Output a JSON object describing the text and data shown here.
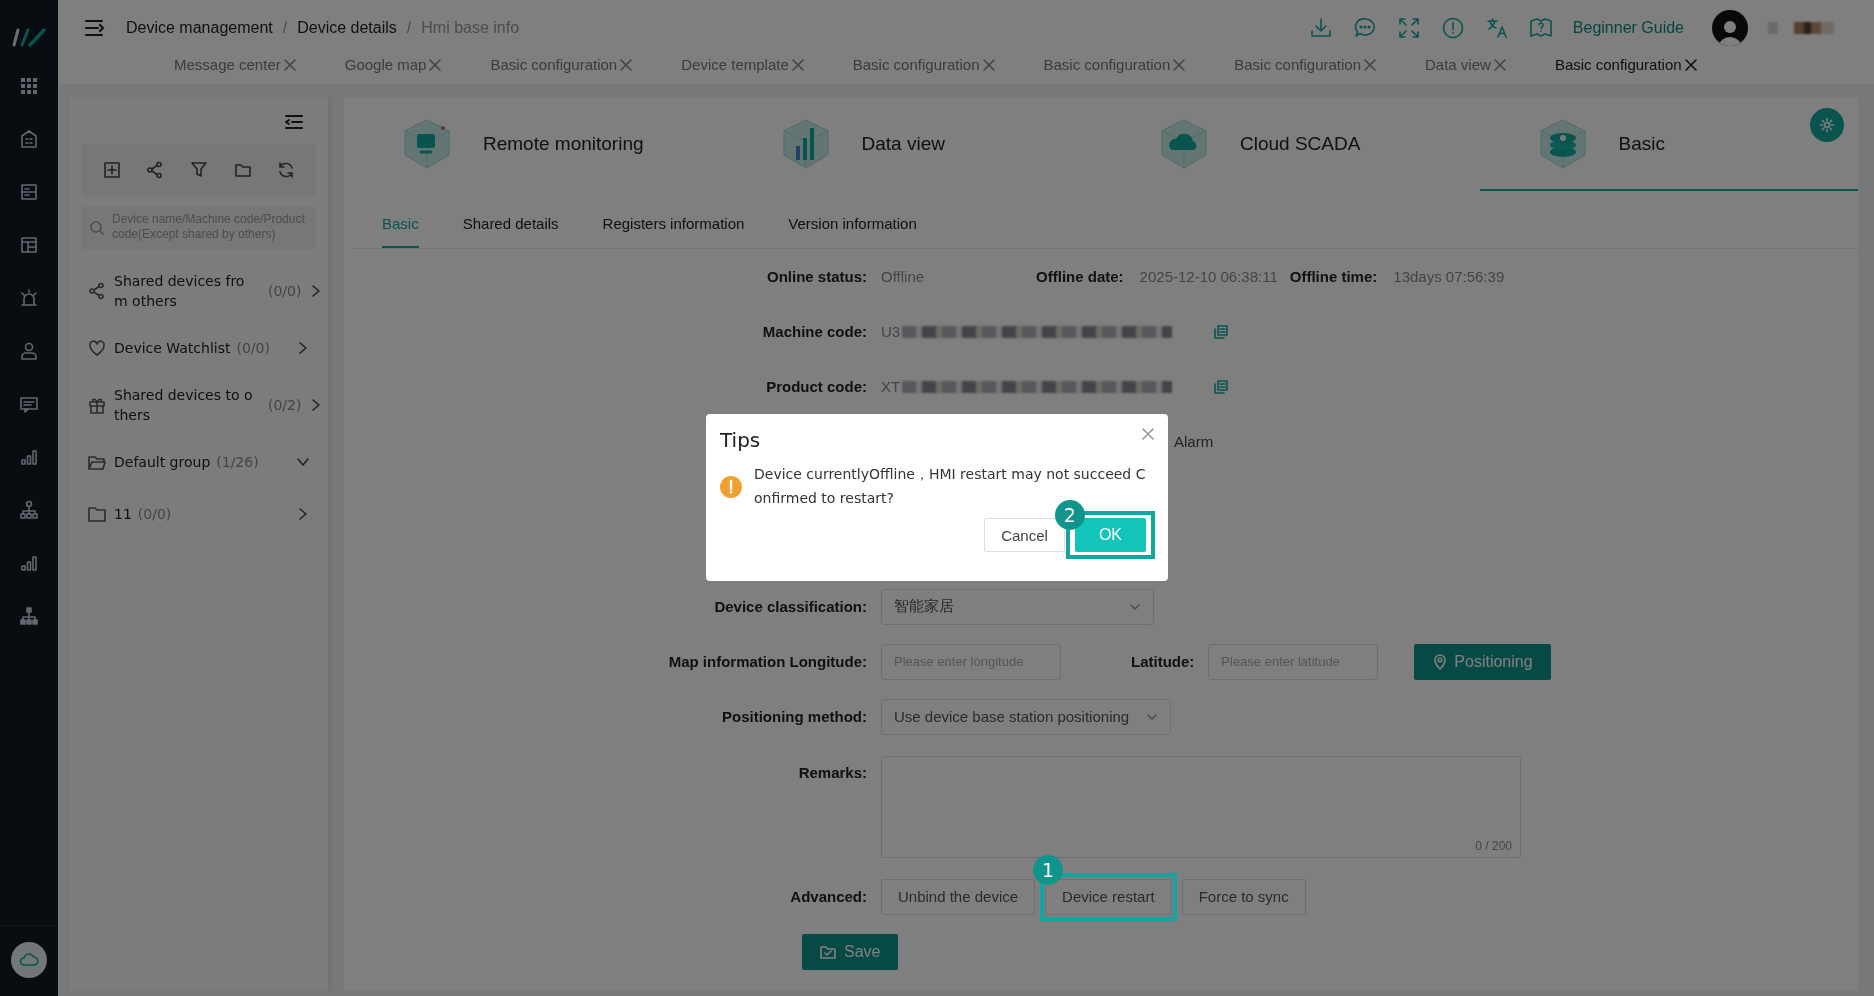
{
  "breadcrumb": [
    {
      "label": "Device management",
      "current": false
    },
    {
      "separator": "/",
      "label": "Device details",
      "current": false
    },
    {
      "separator": "/",
      "label": "Hmi base info",
      "current": true
    }
  ],
  "tabs": [
    {
      "label": "Message center",
      "selected": false
    },
    {
      "label": "Google map",
      "selected": false
    },
    {
      "label": "Basic configuration",
      "selected": false
    },
    {
      "label": "Device template",
      "selected": false
    },
    {
      "label": "Basic configuration",
      "selected": false
    },
    {
      "label": "Basic configuration",
      "selected": false
    },
    {
      "label": "Basic configuration",
      "selected": false
    },
    {
      "label": "Data view",
      "selected": false
    },
    {
      "label": "Basic configuration",
      "selected": true
    }
  ],
  "header": {
    "guide_link": "Beginner Guide"
  },
  "sidebar": {
    "search_placeholder": "Device name/Machine code/Product code(Except shared by others)",
    "items": [
      {
        "kind": "share",
        "label": "Shared devices from others",
        "count": "(0/0)",
        "expanded": false
      },
      {
        "kind": "heart",
        "label": "Device Watchlist",
        "count": "(0/0)",
        "expanded": false
      },
      {
        "kind": "gift",
        "label": "Shared devices to others",
        "count": "(0/2)",
        "expanded": false
      },
      {
        "kind": "folder-open",
        "label": "Default group",
        "count": "(1/26)",
        "expanded": true
      },
      {
        "kind": "folder",
        "label": "11",
        "count": "(0/0)",
        "expanded": false
      }
    ]
  },
  "modules": [
    {
      "label": "Remote monitoring",
      "selected": false
    },
    {
      "label": "Data view",
      "selected": false
    },
    {
      "label": "Cloud SCADA",
      "selected": false
    },
    {
      "label": "Basic",
      "selected": true
    }
  ],
  "subtabs": [
    {
      "label": "Basic",
      "selected": true
    },
    {
      "label": "Shared details",
      "selected": false
    },
    {
      "label": "Registers information",
      "selected": false
    },
    {
      "label": "Version information",
      "selected": false
    }
  ],
  "form": {
    "status": [
      {
        "label": "Online status:",
        "value": "Offline"
      },
      {
        "label": "Offline date:",
        "value": "2025-12-10 06:38:11"
      },
      {
        "label": "Offline time:",
        "value": "13days 07:56:39"
      }
    ],
    "machine_code": {
      "label": "Machine code:",
      "value": "U3"
    },
    "product_code": {
      "label": "Product code:",
      "value": "XT"
    },
    "alarm_fragment": "Alarm",
    "device_classification": {
      "label": "Device classification:",
      "value": "智能家居"
    },
    "longitude": {
      "label": "Map information Longitude:",
      "placeholder": "Please enter longitude"
    },
    "latitude": {
      "label": "Latitude:",
      "placeholder": "Please enter latitude"
    },
    "positioning_button": "Positioning",
    "positioning_method": {
      "label": "Positioning method:",
      "value": "Use device base station positioning"
    },
    "remarks": {
      "label": "Remarks:",
      "counter": "0 / 200"
    },
    "advanced": {
      "label": "Advanced:",
      "buttons": [
        {
          "label": "Unbind the device"
        },
        {
          "label": "Device restart",
          "callout": "1"
        },
        {
          "label": "Force to sync"
        }
      ]
    },
    "save_button": "Save"
  },
  "dialog": {
    "title": "Tips",
    "message": "Device currentlyOffline，HMI restart may not succeed Confirmed to restart?",
    "cancel": "Cancel",
    "ok": "OK",
    "ok_callout": "2"
  }
}
